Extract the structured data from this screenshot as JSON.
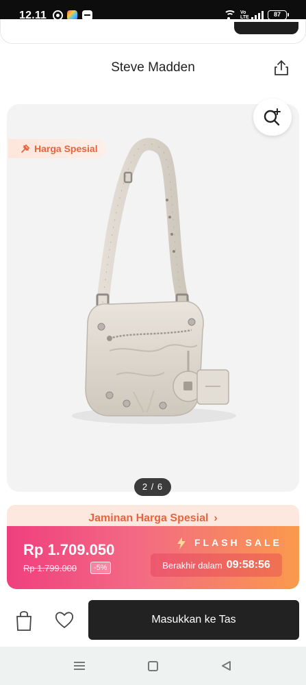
{
  "status_bar": {
    "time": "12.11",
    "volte": "Vo LTE",
    "battery": "87",
    "apps": [
      "whatsapp-icon",
      "colorful-app-icon",
      "message-app-icon"
    ]
  },
  "header": {
    "title": "Steve Madden"
  },
  "product": {
    "image_description": "cream leather shoulder bag with studs, belt buckles and attached pouch",
    "promo_tag": "Harga Spesial",
    "pager": "2 / 6"
  },
  "guarantee": {
    "label": "Jaminan Harga Spesial"
  },
  "flash_sale": {
    "title": "FLASH SALE",
    "current_price": "Rp 1.709.050",
    "original_price": "Rp 1.799.000",
    "discount": "-5%",
    "countdown_label": "Berakhir dalam",
    "countdown_time": "09:58:56"
  },
  "actions": {
    "add_to_bag": "Masukkan ke Tas"
  },
  "colors": {
    "accent": "#e8643c",
    "flash_start": "#ef3f7e",
    "flash_end": "#fa9a4c",
    "button": "#222222"
  }
}
